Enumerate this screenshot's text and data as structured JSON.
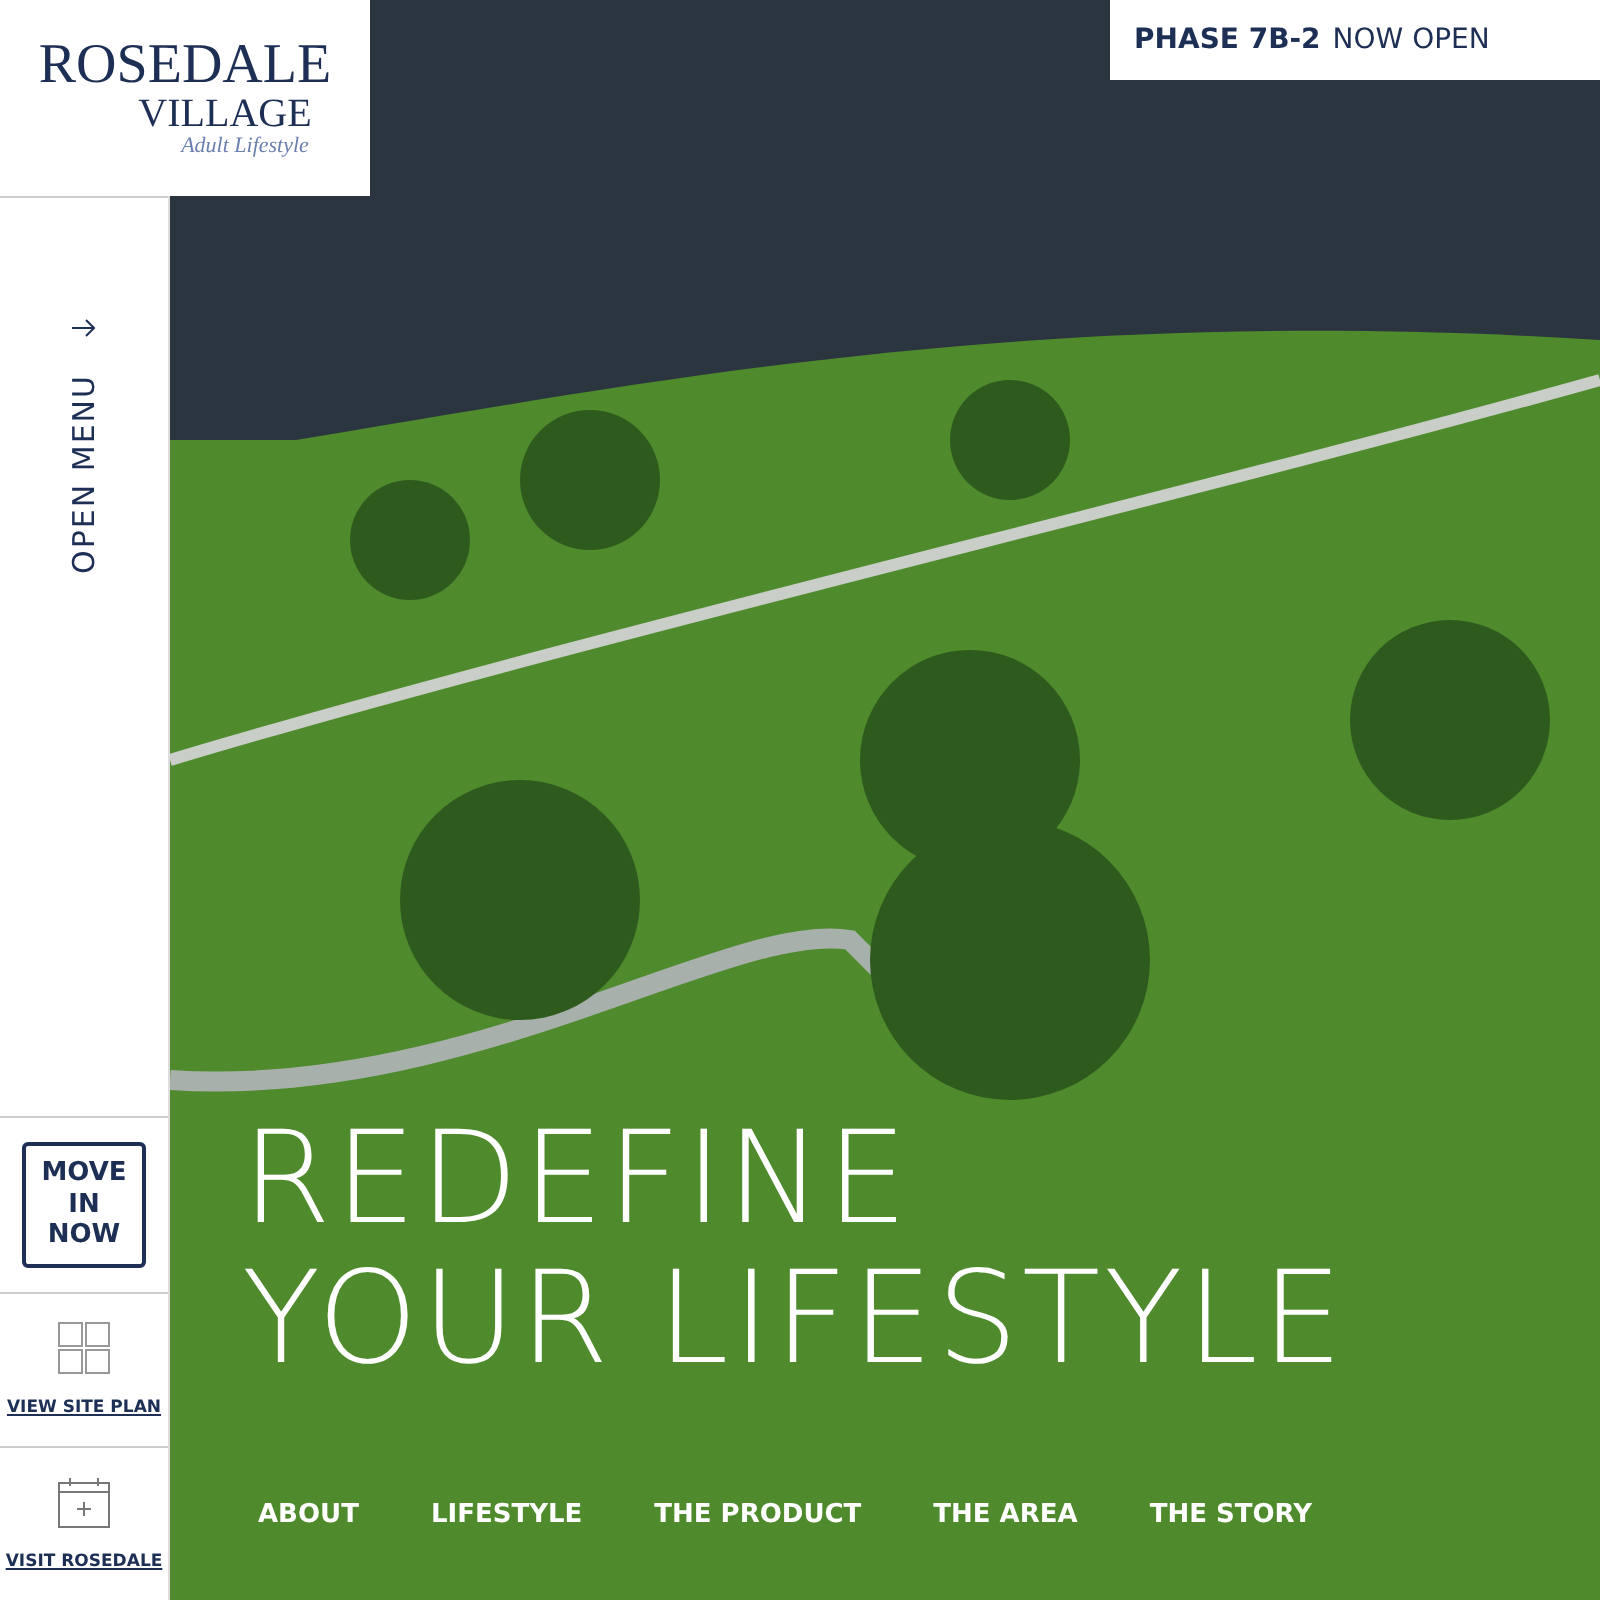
{
  "logo": {
    "name_line_1": "ROSEDALE",
    "name_line_2": "VILLAGE",
    "tagline": "Adult Lifestyle"
  },
  "announcement": {
    "phase": "PHASE 7B-2",
    "status": "NOW OPEN"
  },
  "sidebar": {
    "menu_label": "OPEN MENU",
    "move_in": "MOVE IN NOW",
    "links": [
      {
        "kind": "site-plan",
        "label": "VIEW SITE PLAN"
      },
      {
        "kind": "calendar",
        "label": "VISIT ROSEDALE"
      }
    ]
  },
  "hero": {
    "headline_lines": [
      "REDEFINE",
      "YOUR LIFESTYLE"
    ]
  },
  "nav": [
    "ABOUT",
    "LIFESTYLE",
    "THE PRODUCT",
    "THE AREA",
    "THE STORY"
  ]
}
